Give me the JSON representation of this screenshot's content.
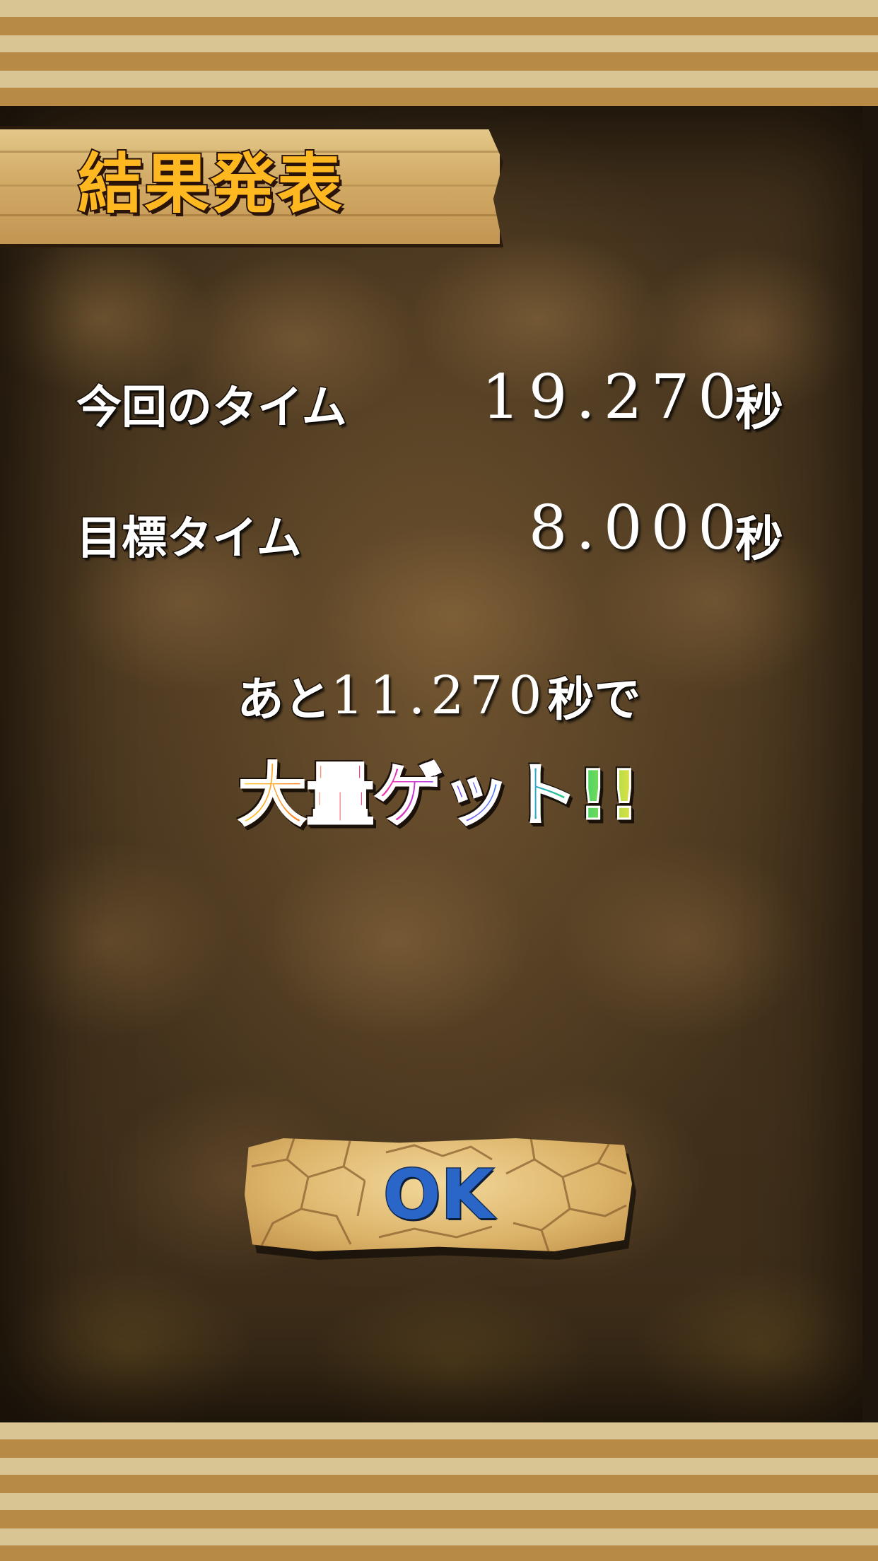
{
  "header": {
    "title": "結果発表"
  },
  "results": {
    "current_time": {
      "label": "今回のタイム",
      "value": "19.270",
      "unit": "秒"
    },
    "target_time": {
      "label": "目標タイム",
      "value": "8.000",
      "unit": "秒"
    }
  },
  "remaining": {
    "prefix": "あと",
    "value": "11.270",
    "suffix": "秒で"
  },
  "bonus_message": "大量ゲット!!",
  "ok_button": {
    "label": "OK"
  },
  "colors": {
    "stripe_light": "#d9c493",
    "stripe_dark": "#b78a45",
    "title_orange": "#ffb820",
    "ok_blue": "#2a66c8"
  }
}
